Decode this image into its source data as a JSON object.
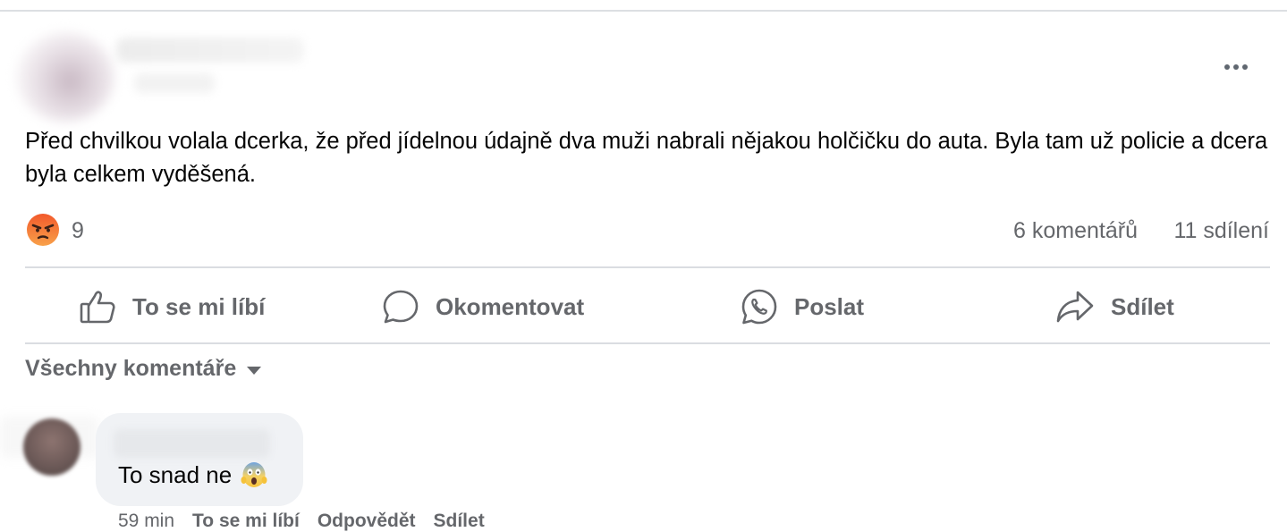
{
  "post": {
    "text": "Před chvilkou volala dcerka, že před jídelnou údajně dva muži nabrali nějakou holčičku do auta. Byla tam už policie a dcera byla celkem vyděšená.",
    "reaction_icon": "angry-face-icon",
    "reaction_count": "9",
    "comments_count": "6 komentářů",
    "shares_count": "11 sdílení"
  },
  "actions": {
    "like": "To se mi líbí",
    "comment": "Okomentovat",
    "send": "Poslat",
    "share": "Sdílet"
  },
  "comments_filter": "Všechny komentáře",
  "comment": {
    "text": "To snad ne",
    "emoji": "face-screaming-in-fear-icon",
    "time": "59 min",
    "like": "To se mi líbí",
    "reply": "Odpovědět",
    "share": "Sdílet"
  },
  "colors": {
    "secondary_text": "#65676b",
    "divider": "#dadde1",
    "bubble": "#f0f2f5",
    "angry": "#f0653a"
  }
}
